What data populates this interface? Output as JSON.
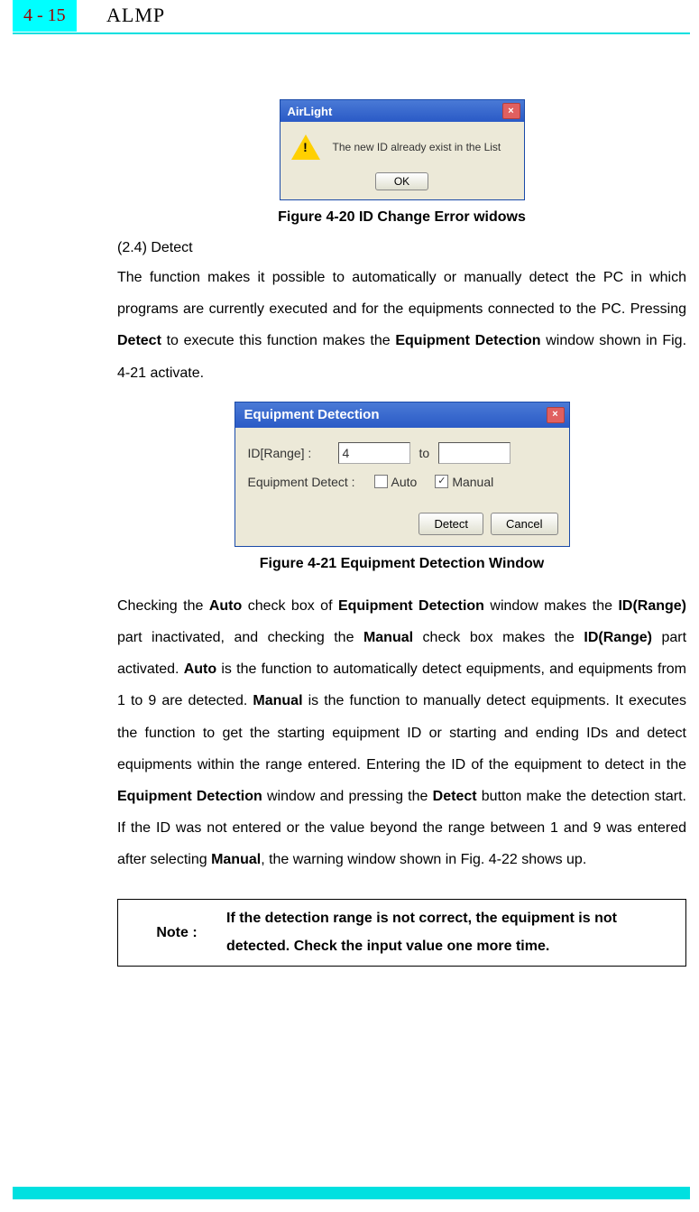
{
  "header": {
    "page_number": "4 - 15",
    "title": "ALMP"
  },
  "dialog1": {
    "title": "AirLight",
    "message": "The new ID already exist in the List",
    "ok_label": "OK"
  },
  "caption1": "Figure 4-20 ID Change Error widows",
  "section_head": "(2.4) Detect",
  "para1_pre": "The function makes it possible to automatically or manually detect the PC in which programs are currently executed and for the equipments connected to the PC. Pressing ",
  "para1_b1": "Detect",
  "para1_mid1": " to execute this function makes the ",
  "para1_b2": "Equipment Detection",
  "para1_mid2": " window shown in Fig. 4-21 activate.",
  "dialog2": {
    "title": "Equipment Detection",
    "id_range_label": "ID[Range] :",
    "id_from_value": "4",
    "to_label": "to",
    "id_to_value": "",
    "detect_mode_label": "Equipment Detect :",
    "auto_label": "Auto",
    "manual_label": "Manual",
    "manual_checked": "✓",
    "detect_btn": "Detect",
    "cancel_btn": "Cancel"
  },
  "caption2": "Figure 4-21 Equipment Detection Window",
  "para2_parts": {
    "t1": "Checking the ",
    "b1": "Auto",
    "t2": " check box of ",
    "b2": "Equipment Detection",
    "t3": " window makes the ",
    "b3": "ID(Range)",
    "t4": " part inactivated, and checking the ",
    "b4": "Manual",
    "t5": " check box makes the ",
    "b5": "ID(Range)",
    "t6": " part activated. ",
    "b6": "Auto",
    "t7": " is the function to automatically detect equipments, and equipments from 1 to 9 are detected. ",
    "b7": "Manual",
    "t8": " is the function to manually detect equipments. It executes the function to get the starting equipment ID or starting and ending IDs and detect equipments within the range entered. Entering the ID of the equipment to detect in the ",
    "b8": "Equipment Detection",
    "t9": " window and pressing the ",
    "b9": "Detect",
    "t10": " button make the detection start. If the ID was not entered or the value beyond the range between 1 and 9 was entered after selecting ",
    "b10": "Manual",
    "t11": ", the warning window shown in Fig. 4-22 shows up."
  },
  "note": {
    "label": "Note :",
    "text": "If the detection range is not correct, the equipment is not detected. Check the input value one more time."
  }
}
